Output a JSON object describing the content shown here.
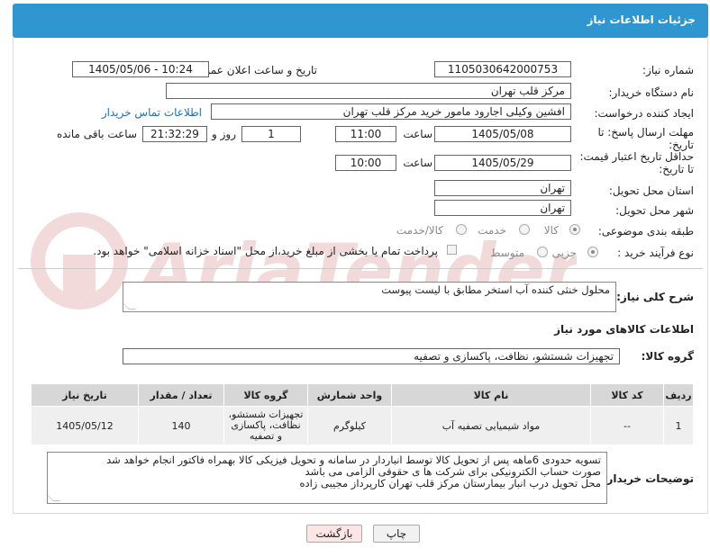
{
  "header": {
    "title": "جزئیات اطلاعات نیاز"
  },
  "fields": {
    "need_number_label": "شماره نیاز:",
    "need_number": "1105030642000753",
    "announce_label": "تاریخ و ساعت اعلان عمومی:",
    "announce_value": "1405/05/06 - 10:24",
    "buyer_org_label": "نام دستگاه خریدار:",
    "buyer_org": "مرکز قلب تهران",
    "creator_label": "ایجاد کننده درخواست:",
    "creator": "افشین وکیلی اجارود مامور خرید مرکز قلب تهران",
    "contact_link": "اطلاعات تماس خریدار",
    "deadline_label": "مهلت ارسال پاسخ: تا تاریخ:",
    "deadline_date": "1405/05/08",
    "hour_label": "ساعت",
    "deadline_time": "11:00",
    "days_value": "1",
    "days_label": "روز و",
    "remaining_time": "21:32:29",
    "remaining_label": "ساعت باقی مانده",
    "price_validity_label": "حداقل تاریخ اعتبار قیمت: تا تاریخ:",
    "price_validity_date": "1405/05/29",
    "price_validity_hour_label": "ساعت",
    "price_validity_time": "10:00",
    "province_label": "استان محل تحویل:",
    "province": "تهران",
    "city_label": "شهر محل تحویل:",
    "city": "تهران",
    "category_label": "طبقه بندی موضوعی:",
    "category_options": [
      "کالا",
      "خدمت",
      "کالا/خدمت"
    ],
    "process_label": "نوع فرآیند خرید :",
    "process_options": [
      "جزیی",
      "متوسط"
    ],
    "payment_note": "پرداخت تمام یا بخشی از مبلغ خرید،از محل \"اسناد خزانه اسلامی\" خواهد بود."
  },
  "description": {
    "label": "شرح کلی نیاز:",
    "value": "محلول خنثی کننده آب استخر مطابق با لیست پیوست"
  },
  "goods_section": {
    "title": "اطلاعات کالاهای مورد نیاز",
    "group_label": "گروه کالا:",
    "group_value": "تجهیزات شستشو، نظافت، پاکسازی و تصفیه"
  },
  "table": {
    "headers": [
      "ردیف",
      "کد کالا",
      "نام کالا",
      "واحد شمارش",
      "گروه کالا",
      "تعداد / مقدار",
      "تاریخ نیاز"
    ],
    "rows": [
      [
        "1",
        "--",
        "مواد شیمیایی تصفیه آب",
        "کیلوگرم",
        "تجهیزات شستشو، نظافت، پاکسازی و تصفیه",
        "140",
        "1405/05/12"
      ]
    ]
  },
  "buyer_notes": {
    "label": "توضیحات خریدار:",
    "lines": [
      "تسویه حدودی 6ماهه پس از تحویل کالا توسط انباردار در سامانه و تحویل فیزیکی کالا بهمراه فاکتور انجام خواهد شد",
      "صورت حساب الکترونیکی برای شرکت ها ی حقوقی الزامی می باشد",
      "محل تحویل درب انبار بیمارستان مرکز قلب تهران کارپرداز مجیبی زاده"
    ]
  },
  "buttons": {
    "print": "چاپ",
    "back": "بازگشت"
  },
  "colors": {
    "header_bg": "#2f96cf",
    "link": "#1e6fb8",
    "back_bg": "#fde5e5"
  }
}
